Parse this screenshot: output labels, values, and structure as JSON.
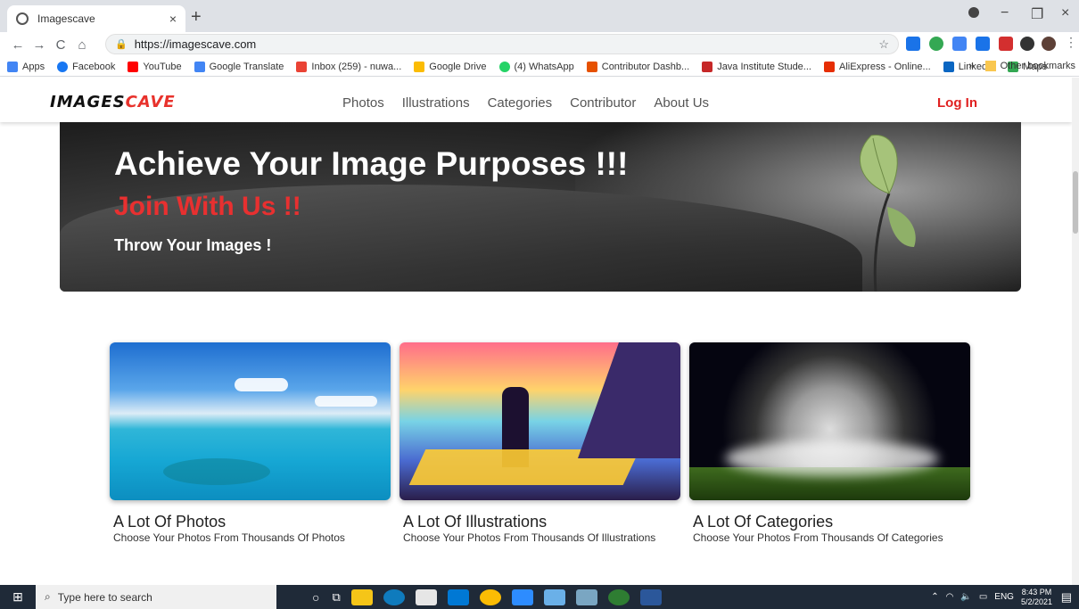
{
  "browser": {
    "tab_title": "Imagescave",
    "tab_close": "×",
    "new_tab": "+",
    "url": "https://imagescave.com",
    "nav": {
      "back": "←",
      "forward": "→",
      "reload": "C",
      "home": "⌂"
    },
    "window_controls": {
      "minimize": "−",
      "restore": "❐",
      "close": "×"
    }
  },
  "bookmarks": [
    {
      "label": "Apps",
      "color": "#4285f4"
    },
    {
      "label": "Facebook",
      "color": "#1877f2"
    },
    {
      "label": "YouTube",
      "color": "#ff0000"
    },
    {
      "label": "Google Translate",
      "color": "#4285f4"
    },
    {
      "label": "Inbox (259) - nuwa...",
      "color": "#ea4335"
    },
    {
      "label": "Google Drive",
      "color": "#fbbc04"
    },
    {
      "label": "(4) WhatsApp",
      "color": "#25d366"
    },
    {
      "label": "Contributor Dashb...",
      "color": "#e65100"
    },
    {
      "label": "Java Institute Stude...",
      "color": "#c62828"
    },
    {
      "label": "AliExpress - Online...",
      "color": "#e62e04"
    },
    {
      "label": "LinkedIn",
      "color": "#0a66c2"
    },
    {
      "label": "Maps",
      "color": "#34a853"
    }
  ],
  "bookmarks_more": "»",
  "other_bookmarks": "Other bookmarks",
  "site": {
    "logo_part1": "IMAGES",
    "logo_part2": "CAVE",
    "nav": [
      "Photos",
      "Illustrations",
      "Categories",
      "Contributor",
      "About Us"
    ],
    "login": "Log In"
  },
  "hero": {
    "headline": "Achieve Your Image Purposes !!!",
    "join": "Join With Us !!",
    "tagline": "Throw Your Images !"
  },
  "cards": [
    {
      "title": "A Lot Of Photos",
      "subtitle": "Choose Your Photos From Thousands Of Photos"
    },
    {
      "title": "A Lot Of Illustrations",
      "subtitle": "Choose Your Photos From Thousands Of Illustrations"
    },
    {
      "title": "A Lot Of Categories",
      "subtitle": "Choose Your Photos From Thousands Of Categories"
    }
  ],
  "taskbar": {
    "search_placeholder": "Type here to search",
    "language": "ENG",
    "time": "8:43 PM",
    "date": "5/2/2021"
  }
}
